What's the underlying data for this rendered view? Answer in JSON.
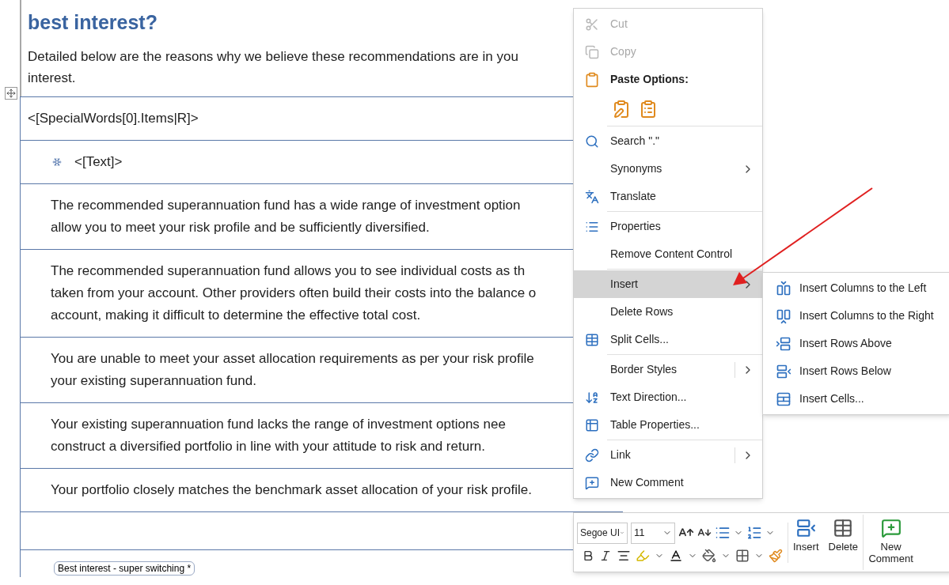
{
  "document": {
    "heading": "best interest?",
    "intro_lines": [
      "Detailed below are the reasons why we believe these recommendations are in you",
      "interest."
    ],
    "rows": [
      {
        "kind": "field",
        "lines": [
          "<[SpecialWords[0].Items|R]>"
        ]
      },
      {
        "kind": "bullet",
        "lines": [
          "<[Text]>"
        ]
      },
      {
        "kind": "text",
        "lines": [
          "The recommended superannuation fund has a wide range of investment option",
          "allow you to meet your risk profile and be sufficiently diversified."
        ]
      },
      {
        "kind": "text",
        "lines": [
          "The recommended superannuation fund allows you to see individual costs as th",
          "taken from your account. Other providers often build their costs into the balance o",
          "account, making it difficult to determine the effective total cost."
        ]
      },
      {
        "kind": "text",
        "lines": [
          "You are unable to meet your asset allocation requirements as per your risk profile",
          "your existing superannuation fund."
        ]
      },
      {
        "kind": "text",
        "lines": [
          "Your existing superannuation fund lacks the range of investment options nee",
          "construct a diversified portfolio in line with your attitude to risk and return."
        ]
      },
      {
        "kind": "text",
        "lines": [
          "Your portfolio closely matches the benchmark asset allocation of your risk profile."
        ]
      },
      {
        "kind": "empty"
      },
      {
        "kind": "tag",
        "lines": [
          "Best interest - super switching *"
        ]
      }
    ]
  },
  "context_menu": {
    "items": [
      {
        "kind": "item",
        "label": "Cut",
        "disabled": true,
        "selected": false
      },
      {
        "kind": "item",
        "label": "Copy",
        "disabled": true,
        "selected": false
      },
      {
        "kind": "header",
        "label": "Paste Options:"
      },
      {
        "kind": "paste_icons"
      },
      {
        "kind": "separator"
      },
      {
        "kind": "item",
        "label": "Search \".\"",
        "disabled": false,
        "selected": false
      },
      {
        "kind": "item",
        "label": "Synonyms",
        "disabled": false,
        "selected": false,
        "submenu": true
      },
      {
        "kind": "item",
        "label": "Translate",
        "disabled": false,
        "selected": false
      },
      {
        "kind": "separator"
      },
      {
        "kind": "item",
        "label": "Properties",
        "disabled": false,
        "selected": false
      },
      {
        "kind": "item",
        "label": "Remove Content Control",
        "disabled": false,
        "selected": false
      },
      {
        "kind": "separator"
      },
      {
        "kind": "item",
        "label": "Insert",
        "disabled": false,
        "selected": true,
        "submenu": true
      },
      {
        "kind": "item",
        "label": "Delete Rows",
        "disabled": false,
        "selected": false
      },
      {
        "kind": "item",
        "label": "Split Cells...",
        "disabled": false,
        "selected": false
      },
      {
        "kind": "separator"
      },
      {
        "kind": "item",
        "label": "Border Styles",
        "disabled": false,
        "selected": false,
        "submenu": true,
        "split": true
      },
      {
        "kind": "item",
        "label": "Text Direction...",
        "disabled": false,
        "selected": false
      },
      {
        "kind": "item",
        "label": "Table Properties...",
        "disabled": false,
        "selected": false
      },
      {
        "kind": "separator"
      },
      {
        "kind": "item",
        "label": "Link",
        "disabled": false,
        "selected": false,
        "submenu": true,
        "split": true
      },
      {
        "kind": "item",
        "label": "New Comment",
        "disabled": false,
        "selected": false
      }
    ]
  },
  "submenu": {
    "items": [
      {
        "label": "Insert Columns to the Left"
      },
      {
        "label": "Insert Columns to the Right"
      },
      {
        "label": "Insert Rows Above"
      },
      {
        "label": "Insert Rows Below"
      },
      {
        "label": "Insert Cells..."
      }
    ]
  },
  "mini_toolbar": {
    "font": "Segoe UI",
    "size": "11",
    "buttons": [
      {
        "label": "Insert"
      },
      {
        "label": "Delete"
      },
      {
        "label": "New Comment"
      }
    ]
  }
}
